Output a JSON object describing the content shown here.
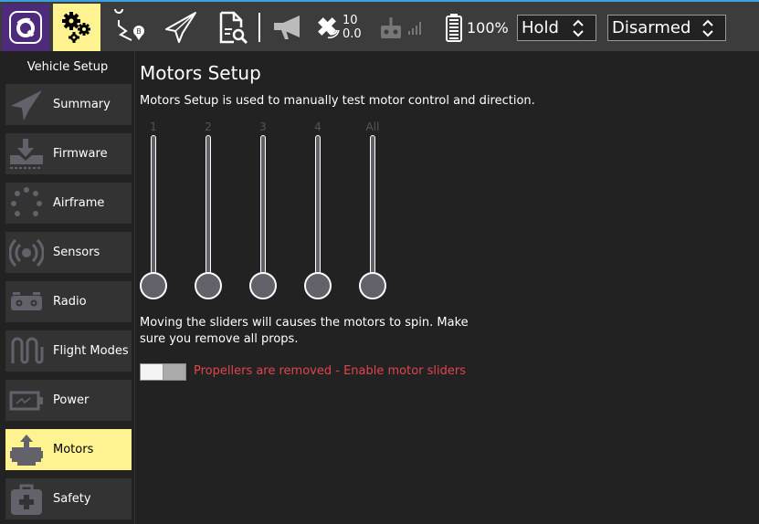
{
  "toolbar": {
    "gps_count": "10",
    "gps_hdop": "0.0",
    "battery": "100%",
    "flight_mode": "Hold",
    "arm_state": "Disarmed"
  },
  "colors": {
    "accent_active": "#fff291",
    "logo_bg": "#4d2a7a",
    "warning_text": "#e0454c",
    "top_border": "#3f9fdb"
  },
  "sidebar": {
    "title": "Vehicle Setup",
    "items": [
      {
        "label": "Summary",
        "icon": "paper-plane-icon"
      },
      {
        "label": "Firmware",
        "icon": "download-icon"
      },
      {
        "label": "Airframe",
        "icon": "airframe-icon"
      },
      {
        "label": "Sensors",
        "icon": "sensors-icon"
      },
      {
        "label": "Radio",
        "icon": "radio-icon"
      },
      {
        "label": "Flight Modes",
        "icon": "flight-modes-icon"
      },
      {
        "label": "Power",
        "icon": "power-icon"
      },
      {
        "label": "Motors",
        "icon": "motors-icon",
        "active": true
      },
      {
        "label": "Safety",
        "icon": "safety-icon"
      }
    ]
  },
  "main": {
    "title": "Motors Setup",
    "description": "Motors Setup is used to manually test motor control and direction.",
    "sliders": [
      {
        "label": "1",
        "value": 0
      },
      {
        "label": "2",
        "value": 0
      },
      {
        "label": "3",
        "value": 0
      },
      {
        "label": "4",
        "value": 0
      },
      {
        "label": "All",
        "value": 0
      }
    ],
    "warning": "Moving the sliders will causes the motors to spin. Make sure you remove all props.",
    "toggle_label": "Propellers are removed - Enable motor sliders",
    "toggle_on": false
  }
}
